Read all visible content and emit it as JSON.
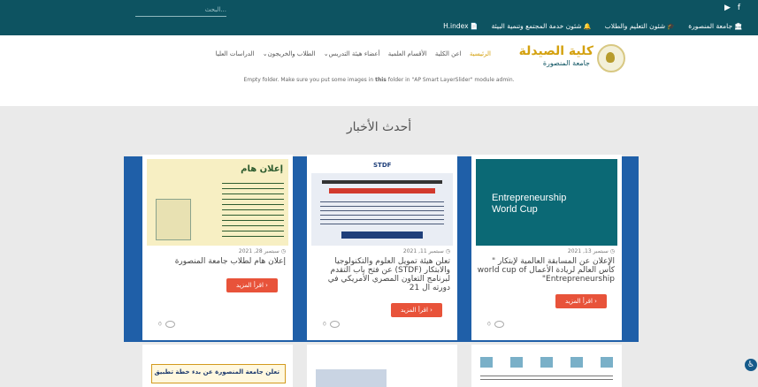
{
  "topbar": {
    "search_placeholder": "البحث...",
    "social": [
      "f",
      "▶"
    ],
    "quick_links": [
      {
        "icon": "🏛",
        "label": "جامعة المنصورة"
      },
      {
        "icon": "🎓",
        "label": "شئون التعليم والطلاب"
      },
      {
        "icon": "🔔",
        "label": "شئون خدمة المجتمع وتنمية البيئة"
      },
      {
        "icon": "📄",
        "label": "H.index"
      }
    ]
  },
  "header": {
    "logo_title": "كلية الصيدلة",
    "logo_subtitle": "جامعة المنصورة",
    "nav": [
      {
        "label": "الرئيسية",
        "state": "active"
      },
      {
        "label": "اعن الكلية",
        "state": "normal"
      },
      {
        "label": "الأقسام العلمية",
        "state": "normal"
      },
      {
        "label": "أعضاء هيئة التدريس",
        "state": "dropdown"
      },
      {
        "label": "الطلاب والخريجون",
        "state": "dropdown"
      },
      {
        "label": "الدراسات العليا",
        "state": "normal"
      }
    ]
  },
  "notice": {
    "pre": "Empty folder. Make sure you put some images in ",
    "bold": "this",
    "post": " folder in \"AP Smart LayerSlider\" module admin."
  },
  "news": {
    "section_title": "أحدث الأخبار",
    "cards": [
      {
        "date": "سبتمبر 28, 2021",
        "title": "إعلان هام لطلاب جامعة المنصورة",
        "button": "اقرأ المزيد ›",
        "views": "0",
        "image_text": "إعلان هام"
      },
      {
        "date": "سبتمبر 11, 2021",
        "title": "تعلن هيئة تمويل العلوم والتكنولوجيا والابتكار (STDF) عن فتح باب التقدم لبرنامج التعاون المصري الأمريكي في دورته ال 21",
        "button": "اقرأ المزيد ›",
        "views": "0",
        "image_text": "STDF"
      },
      {
        "date": "سبتمبر 13, 2021",
        "title": "الإعلان عن المسابقة العالمية لإبتكار \" كأس العالم لريادة الأعمال world cup of Entrepreneurship\"",
        "button": "اقرأ المزيد ›",
        "views": "0",
        "image_text": "Entrepreneurship World Cup"
      }
    ],
    "row2_text": "تعلن جامعة المنصورة عن بدء خطة تطبيق"
  },
  "accessibility_icon": "♿"
}
